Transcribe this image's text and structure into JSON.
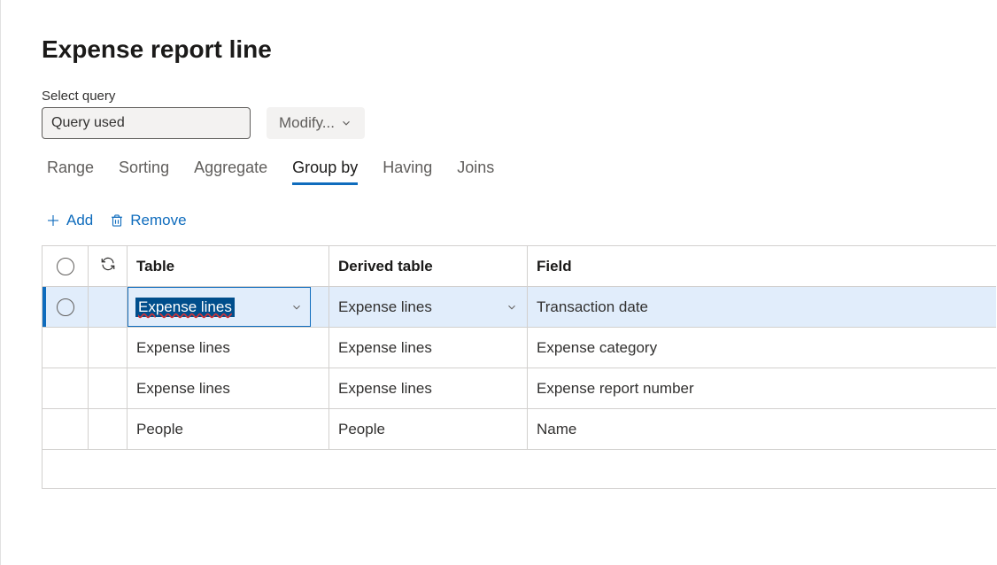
{
  "title": "Expense report line",
  "selectQuery": {
    "label": "Select query",
    "value": "Query used",
    "modifyLabel": "Modify..."
  },
  "tabs": [
    {
      "label": "Range",
      "active": false
    },
    {
      "label": "Sorting",
      "active": false
    },
    {
      "label": "Aggregate",
      "active": false
    },
    {
      "label": "Group by",
      "active": true
    },
    {
      "label": "Having",
      "active": false
    },
    {
      "label": "Joins",
      "active": false
    }
  ],
  "toolbar": {
    "addLabel": "Add",
    "removeLabel": "Remove"
  },
  "grid": {
    "columns": {
      "table": "Table",
      "derived": "Derived table",
      "field": "Field"
    },
    "rows": [
      {
        "table": "Expense lines",
        "derived": "Expense lines",
        "field": "Transaction date",
        "selected": true,
        "editing": true
      },
      {
        "table": "Expense lines",
        "derived": "Expense lines",
        "field": "Expense category",
        "selected": false,
        "editing": false
      },
      {
        "table": "Expense lines",
        "derived": "Expense lines",
        "field": "Expense report number",
        "selected": false,
        "editing": false
      },
      {
        "table": "People",
        "derived": "People",
        "field": "Name",
        "selected": false,
        "editing": false
      }
    ]
  }
}
